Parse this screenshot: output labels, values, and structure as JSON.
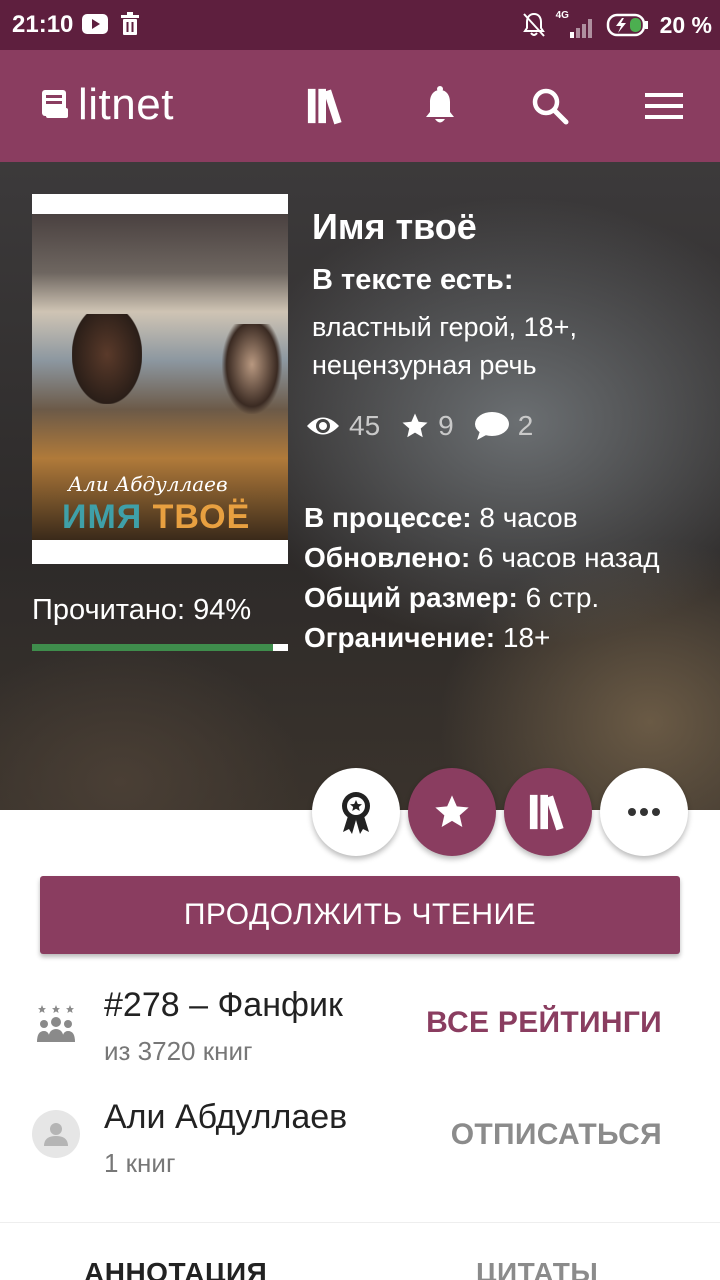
{
  "status_bar": {
    "time": "21:10",
    "network": "4G",
    "battery": "20 %"
  },
  "appbar": {
    "logo": "litnet",
    "icons": [
      "library-icon",
      "bell-icon",
      "search-icon",
      "menu-icon"
    ]
  },
  "book": {
    "title": "Имя твоё",
    "cover_author": "Али Абдуллаев",
    "cover_title_part1": "ИМЯ ",
    "cover_title_part2": "ТВОЁ",
    "tags_heading": "В тексте есть:",
    "tags": "властный герой, 18+, нецензурная речь",
    "views": "45",
    "stars": "9",
    "comments": "2",
    "read_progress_label": "Прочитано: 94%",
    "read_progress": 0.94,
    "meta": [
      {
        "label": "В процессе:",
        "value": " 8 часов"
      },
      {
        "label": "Обновлено:",
        "value": " 6 часов назад"
      },
      {
        "label": "Общий размер:",
        "value": " 6 стр."
      },
      {
        "label": "Ограничение:",
        "value": " 18+"
      }
    ]
  },
  "actions": {
    "continue_label": "ПРОДОЛЖИТЬ ЧТЕНИЕ"
  },
  "rating": {
    "title": "#278 – Фанфик",
    "subtitle": "из 3720 книг",
    "action": "ВСЕ РЕЙТИНГИ"
  },
  "author": {
    "name": "Али Абдуллаев",
    "books": "1 книг",
    "action": "ОТПИСАТЬСЯ"
  },
  "tabs": [
    "АННОТАЦИЯ",
    "ЦИТАТЫ"
  ],
  "colors": {
    "primary": "#8a3d60",
    "status_bar": "#5e1f3e",
    "progress": "#3f8d4c"
  }
}
